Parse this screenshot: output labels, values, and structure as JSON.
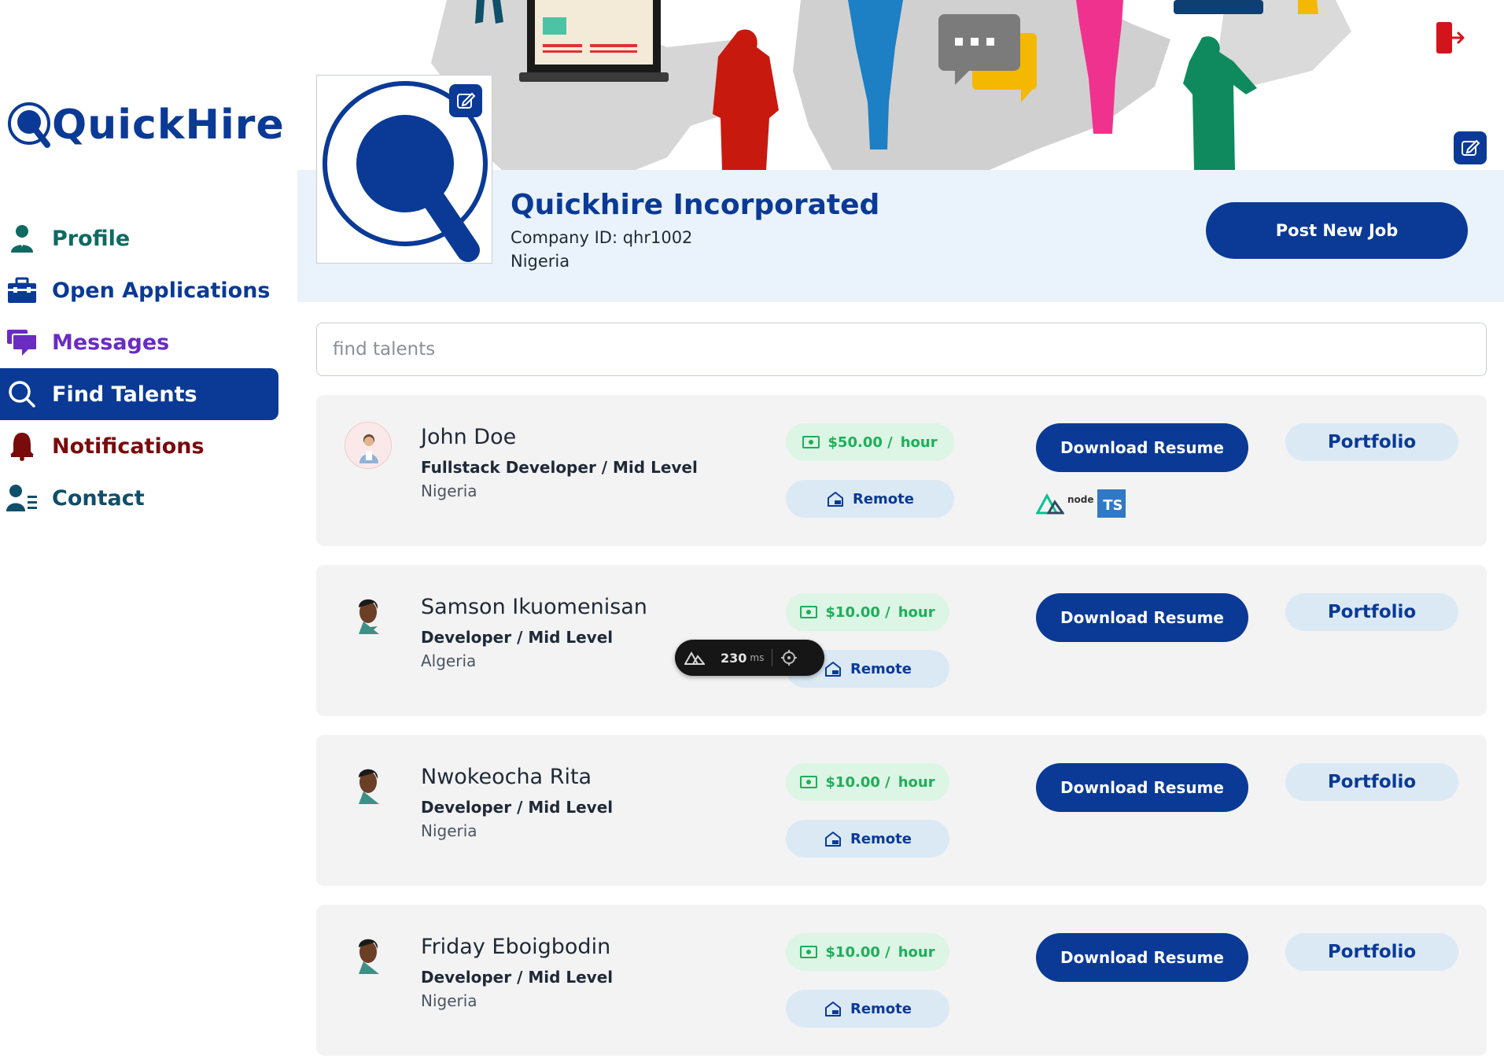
{
  "brand": {
    "name": "QuickHire",
    "primary": "#0a3a96"
  },
  "sidebar": {
    "items": [
      {
        "label": "Profile",
        "icon": "user-icon",
        "color": "#0e6a62",
        "active": false
      },
      {
        "label": "Open Applications",
        "icon": "briefcase-icon",
        "color": "#0a3a96",
        "active": false
      },
      {
        "label": "Messages",
        "icon": "chat-icon",
        "color": "#6a2bc2",
        "active": false
      },
      {
        "label": "Find Talents",
        "icon": "search-icon",
        "color": "#ffffff",
        "active": true
      },
      {
        "label": "Notifications",
        "icon": "bell-icon",
        "color": "#7a0b0b",
        "active": false
      },
      {
        "label": "Contact",
        "icon": "contact-list-icon",
        "color": "#0e4f6a",
        "active": false
      }
    ]
  },
  "company": {
    "name": "Quickhire Incorporated",
    "id_text": "Company ID: qhr1002",
    "country": "Nigeria",
    "post_job_label": "Post New Job"
  },
  "search": {
    "placeholder": "find talents",
    "value": ""
  },
  "talents": [
    {
      "name": "John Doe",
      "role": "Fullstack Developer / Mid Level",
      "country": "Nigeria",
      "rate": "$50.00 /",
      "rate_unit": "hour",
      "work_mode": "Remote",
      "download_label": "Download Resume",
      "portfolio_label": "Portfolio",
      "skills": [
        "nuxt-icon",
        "node-icon",
        "typescript-icon"
      ],
      "skill_text": {
        "node": "node",
        "ts": "TS"
      }
    },
    {
      "name": "Samson Ikuomenisan",
      "role": "Developer / Mid Level",
      "country": "Algeria",
      "rate": "$10.00 /",
      "rate_unit": "hour",
      "work_mode": "Remote",
      "download_label": "Download Resume",
      "portfolio_label": "Portfolio"
    },
    {
      "name": "Nwokeocha Rita",
      "role": "Developer / Mid Level",
      "country": "Nigeria",
      "rate": "$10.00 /",
      "rate_unit": "hour",
      "work_mode": "Remote",
      "download_label": "Download Resume",
      "portfolio_label": "Portfolio"
    },
    {
      "name": "Friday Eboigbodin",
      "role": "Developer / Mid Level",
      "country": "Nigeria",
      "rate": "$10.00 /",
      "rate_unit": "hour",
      "work_mode": "Remote",
      "download_label": "Download Resume",
      "portfolio_label": "Portfolio"
    }
  ],
  "devtools": {
    "value": "230",
    "unit": "ms"
  }
}
